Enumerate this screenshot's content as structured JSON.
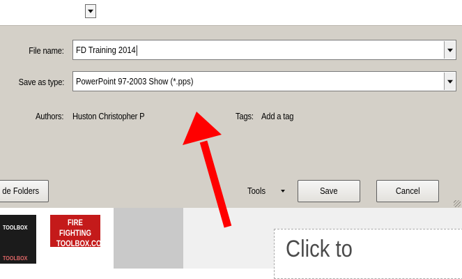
{
  "dialog": {
    "file_name_label": "File name:",
    "file_name_value": "FD Training 2014",
    "save_type_label": "Save as type:",
    "save_type_value": "PowerPoint 97-2003 Show (*.pps)",
    "authors_label": "Authors:",
    "authors_value": "Huston Christopher P",
    "tags_label": "Tags:",
    "tags_value": "Add a tag",
    "hide_folders_label": "de Folders",
    "tools_label": "Tools",
    "save_label": "Save",
    "cancel_label": "Cancel"
  },
  "background": {
    "toolbox_label_top": "TOOLBOX",
    "toolbox_label_bottom": "TOOLBOX",
    "logo_line1": "FIRE FIGHTING",
    "logo_line2": "TOOLBOX.COM",
    "slide_placeholder": "Click to"
  },
  "annotation": {
    "arrow_color": "#ff0000"
  }
}
